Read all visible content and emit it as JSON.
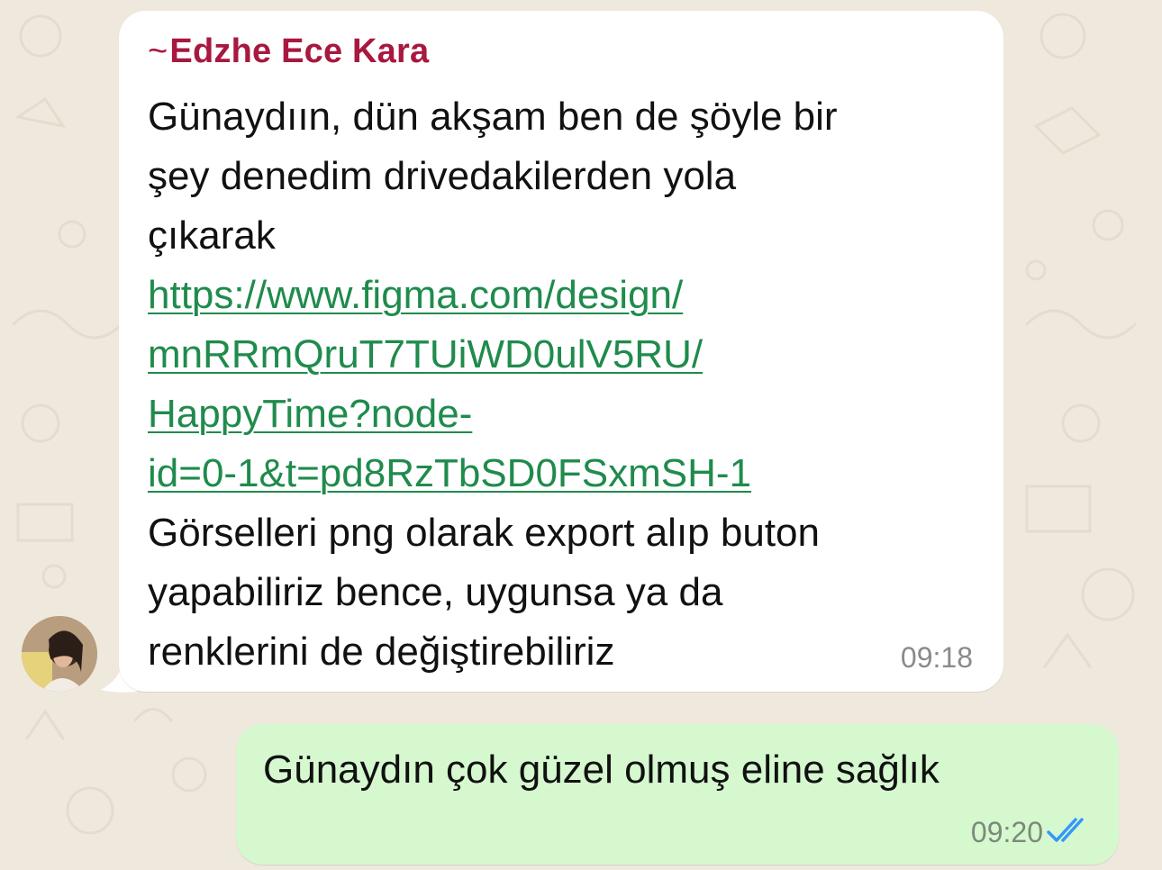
{
  "colors": {
    "wallpaper": "#efe9dd",
    "incoming_bubble": "#ffffff",
    "outgoing_bubble": "#d6f8cf",
    "sender_name": "#a8183f",
    "link": "#1f8b4c",
    "read_ticks": "#3497f9"
  },
  "incoming": {
    "sender_prefix": "~",
    "sender_name": "Edzhe Ece Kara",
    "avatar_icon": "user-photo",
    "lines": [
      "Günaydıın, dün akşam ben de şöyle bir",
      "şey denedim drivedakilerden yola",
      "çıkarak"
    ],
    "link_lines": [
      "https://www.figma.com/design/",
      "mnRRmQruT7TUiWD0ulV5RU/",
      "HappyTime?node-",
      "id=0-1&t=pd8RzTbSD0FSxmSH-1"
    ],
    "after_lines": [
      "Görselleri png olarak export alıp buton",
      "yapabiliriz bence, uygunsa ya da",
      "renklerini de değiştirebiliriz"
    ],
    "time": "09:18"
  },
  "outgoing": {
    "text": "Günaydın çok güzel olmuş eline sağlık",
    "time": "09:20",
    "status_icon": "double-check-read"
  }
}
